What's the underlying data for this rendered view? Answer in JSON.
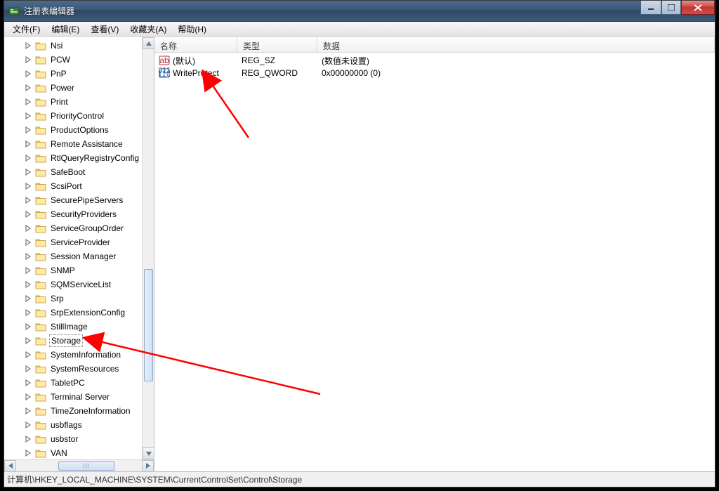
{
  "title": "注册表编辑器",
  "menu": [
    "文件(F)",
    "编辑(E)",
    "查看(V)",
    "收藏夹(A)",
    "帮助(H)"
  ],
  "tree_items": [
    "Nsi",
    "PCW",
    "PnP",
    "Power",
    "Print",
    "PriorityControl",
    "ProductOptions",
    "Remote Assistance",
    "RtlQueryRegistryConfig",
    "SafeBoot",
    "ScsiPort",
    "SecurePipeServers",
    "SecurityProviders",
    "ServiceGroupOrder",
    "ServiceProvider",
    "Session Manager",
    "SNMP",
    "SQMServiceList",
    "Srp",
    "SrpExtensionConfig",
    "StillImage",
    "Storage",
    "SystemInformation",
    "SystemResources",
    "TabletPC",
    "Terminal Server",
    "TimeZoneInformation",
    "usbflags",
    "usbstor",
    "VAN"
  ],
  "selected_tree_index": 21,
  "columns": {
    "name": "名称",
    "type": "类型",
    "data": "数据"
  },
  "rows": [
    {
      "icon": "sz",
      "name": "(默认)",
      "type": "REG_SZ",
      "data": "(数值未设置)"
    },
    {
      "icon": "bin",
      "name": "WriteProtect",
      "type": "REG_QWORD",
      "data": "0x00000000 (0)"
    }
  ],
  "status_path": "计算机\\HKEY_LOCAL_MACHINE\\SYSTEM\\CurrentControlSet\\Control\\Storage"
}
